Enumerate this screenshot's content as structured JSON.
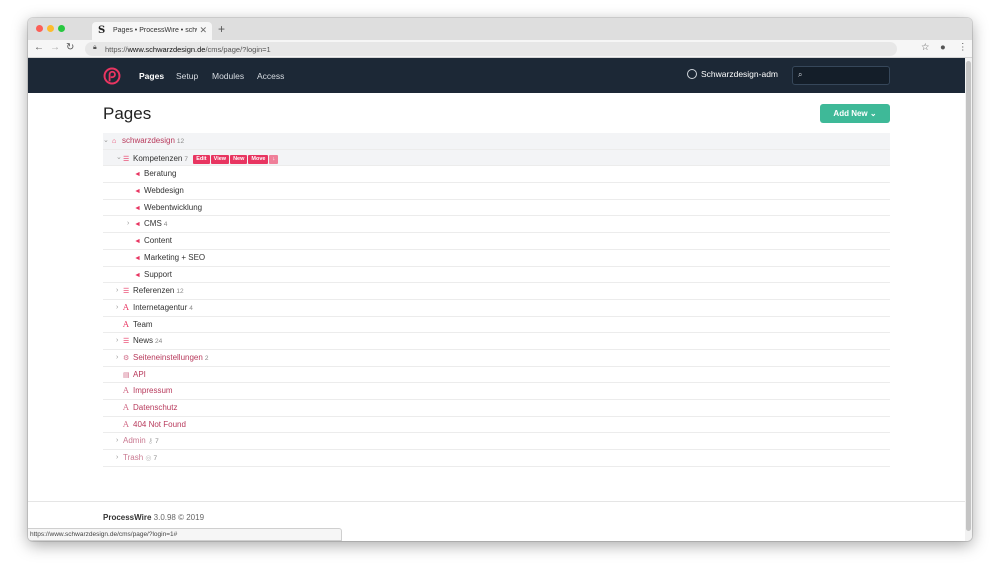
{
  "browser": {
    "tab_title": "Pages • ProcessWire • schwarzdesign.de",
    "favicon_letter": "S",
    "close_glyph": "✕",
    "new_tab_glyph": "+",
    "url_prefix": "https://",
    "url_host": "www.schwarzdesign.de",
    "url_path": "/cms/page/?login=1",
    "status_url": "https://www.schwarzdesign.de/cms/page/?login=1#"
  },
  "header": {
    "nav": [
      {
        "label": "Pages"
      },
      {
        "label": "Setup"
      },
      {
        "label": "Modules"
      },
      {
        "label": "Access"
      }
    ],
    "user": "Schwarzdesign-adm",
    "search_placeholder": ""
  },
  "main": {
    "title": "Pages",
    "add_new_label": "Add New ⌄"
  },
  "tree": {
    "root": {
      "label": "schwarzdesign",
      "count": "12"
    },
    "rows": [
      {
        "label": "Kompetenzen",
        "count": "7"
      },
      {
        "label": "Beratung"
      },
      {
        "label": "Webdesign"
      },
      {
        "label": "Webentwicklung"
      },
      {
        "label": "CMS",
        "count": "4"
      },
      {
        "label": "Content"
      },
      {
        "label": "Marketing + SEO"
      },
      {
        "label": "Support"
      },
      {
        "label": "Referenzen",
        "count": "12"
      },
      {
        "label": "Internetagentur",
        "count": "4"
      },
      {
        "label": "Team"
      },
      {
        "label": "News",
        "count": "24"
      },
      {
        "label": "Seiteneinstellungen",
        "count": "2"
      },
      {
        "label": "API"
      },
      {
        "label": "Impressum"
      },
      {
        "label": "Datenschutz"
      },
      {
        "label": "404 Not Found"
      },
      {
        "label": "Admin",
        "count": "7"
      },
      {
        "label": "Trash",
        "count": "7"
      }
    ],
    "actions": {
      "edit": "Edit",
      "view": "View",
      "new": "New",
      "move": "Move",
      "more": "↓"
    }
  },
  "footer": {
    "brand": "ProcessWire",
    "version": "3.0.98 © 2019"
  },
  "colors": {
    "accent": "#e83561",
    "header_bg": "#1c2836",
    "add_button": "#3eb998"
  }
}
